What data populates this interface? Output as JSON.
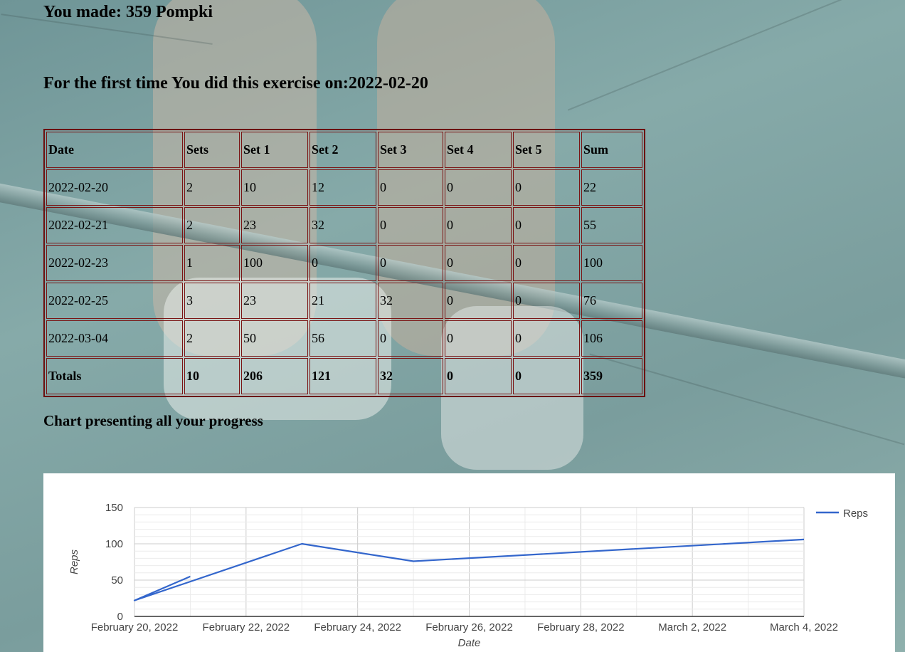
{
  "header": {
    "made_prefix": "You made: ",
    "made_total": "359",
    "made_exercise": "Pompki",
    "first_time_label": "For the first time You did this exercise on:",
    "first_time_date": "2022-02-20"
  },
  "table": {
    "columns": [
      "Date",
      "Sets",
      "Set 1",
      "Set 2",
      "Set 3",
      "Set 4",
      "Set 5",
      "Sum"
    ],
    "rows": [
      [
        "2022-02-20",
        "2",
        "10",
        "12",
        "0",
        "0",
        "0",
        "22"
      ],
      [
        "2022-02-21",
        "2",
        "23",
        "32",
        "0",
        "0",
        "0",
        "55"
      ],
      [
        "2022-02-23",
        "1",
        "100",
        "0",
        "0",
        "0",
        "0",
        "100"
      ],
      [
        "2022-02-25",
        "3",
        "23",
        "21",
        "32",
        "0",
        "0",
        "76"
      ],
      [
        "2022-03-04",
        "2",
        "50",
        "56",
        "0",
        "0",
        "0",
        "106"
      ]
    ],
    "totals": [
      "Totals",
      "10",
      "206",
      "121",
      "32",
      "0",
      "0",
      "359"
    ]
  },
  "chart_heading": "Chart presenting all your progress",
  "chart_data": {
    "type": "line",
    "xlabel": "Date",
    "ylabel": "Reps",
    "ylim": [
      0,
      150
    ],
    "yticks": [
      "0",
      "50",
      "100",
      "150"
    ],
    "xticks": [
      "February 20, 2022",
      "February 22, 2022",
      "February 24, 2022",
      "February 26, 2022",
      "February 28, 2022",
      "March 2, 2022",
      "March 4, 2022"
    ],
    "grid": true,
    "legend_position": "right",
    "series": [
      {
        "name": "Reps",
        "color": "#3366cc",
        "points": [
          {
            "x": "2022-02-21",
            "y": 55
          },
          {
            "x": "2022-02-20",
            "y": 22
          },
          {
            "x": "2022-02-23",
            "y": 100
          },
          {
            "x": "2022-02-25",
            "y": 76
          },
          {
            "x": "2022-03-04",
            "y": 106
          }
        ]
      }
    ]
  }
}
